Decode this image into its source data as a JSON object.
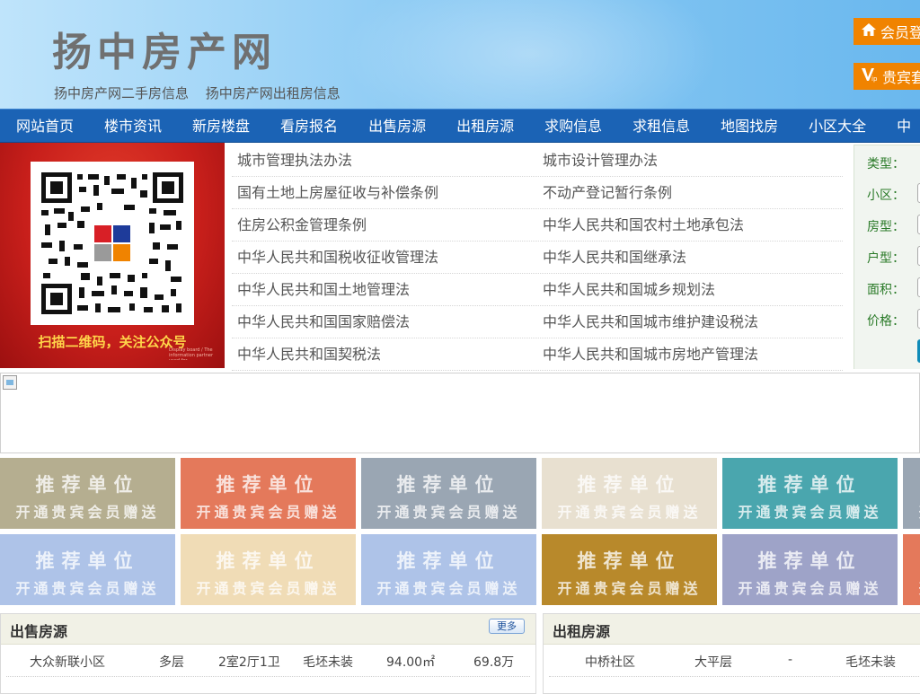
{
  "header": {
    "title": "扬中房产网",
    "sub_links": [
      "扬中房产网二手房信息",
      "扬中房产网出租房信息"
    ],
    "login_label": "会员登",
    "vip_label": "贵宾套"
  },
  "nav": [
    "网站首页",
    "楼市资讯",
    "新房楼盘",
    "看房报名",
    "出售房源",
    "出租房源",
    "求购信息",
    "求租信息",
    "地图找房",
    "小区大全",
    "中"
  ],
  "banner": {
    "caption": "扫描二维码，关注公众号",
    "fine_print": "Display board / The information partner used for..."
  },
  "laws": [
    [
      "城市管理执法办法",
      "城市设计管理办法"
    ],
    [
      "国有土地上房屋征收与补偿条例",
      "不动产登记暂行条例"
    ],
    [
      "住房公积金管理条例",
      "中华人民共和国农村土地承包法"
    ],
    [
      "中华人民共和国税收征收管理法",
      "中华人民共和国继承法"
    ],
    [
      "中华人民共和国土地管理法",
      "中华人民共和国城乡规划法"
    ],
    [
      "中华人民共和国国家赔偿法",
      "中华人民共和国城市维护建设税法"
    ],
    [
      "中华人民共和国契税法",
      "中华人民共和国城市房地产管理法"
    ]
  ],
  "search": {
    "labels": [
      "类型：",
      "小区：",
      "房型：",
      "户型：",
      "面积：",
      "价格："
    ]
  },
  "tiles": {
    "line1": "推荐单位",
    "line2": "开通贵宾会员赠送",
    "colors_row1": [
      "#b5ae90",
      "#e4795b",
      "#9aa6b3",
      "#e8e0d0",
      "#4aa6ae",
      "#9aa6b3"
    ],
    "colors_row2": [
      "#aec3e8",
      "#f0dcb6",
      "#aec3e8",
      "#b8892b",
      "#9ea3c8",
      "#e4795b"
    ]
  },
  "sale": {
    "title": "出售房源",
    "more": "更多",
    "rows": [
      [
        "大众新联小区",
        "多层",
        "2室2厅1卫",
        "毛坯未装",
        "94.00㎡",
        "69.8万"
      ]
    ]
  },
  "rent": {
    "title": "出租房源",
    "rows": [
      [
        "中桥社区",
        "大平层",
        "-",
        "毛坯未装"
      ]
    ]
  }
}
